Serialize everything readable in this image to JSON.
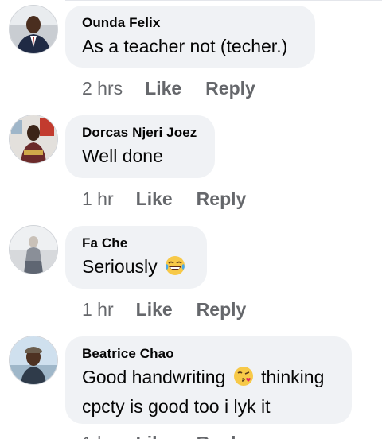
{
  "comments": [
    {
      "author": "Ounda Felix",
      "text": "As a teacher not (techer.)",
      "time": "2 hrs",
      "like_label": "Like",
      "reply_label": "Reply"
    },
    {
      "author": "Dorcas Njeri Joez",
      "text": "Well done",
      "time": "1 hr",
      "like_label": "Like",
      "reply_label": "Reply"
    },
    {
      "author": "Fa Che",
      "text": "Seriously",
      "emoji": "face-with-tears-of-joy-emoji",
      "time": "1 hr",
      "like_label": "Like",
      "reply_label": "Reply"
    },
    {
      "author": "Beatrice Chao",
      "text_line1": "Good handwriting",
      "emoji": "face-blowing-a-kiss-emoji",
      "text_line1_after": "thinking",
      "text_line2": "cpcty is good too i lyk it"
    }
  ],
  "colors": {
    "bubble": "#f0f2f5",
    "meta_text": "#65676b",
    "main_text": "#050505"
  }
}
